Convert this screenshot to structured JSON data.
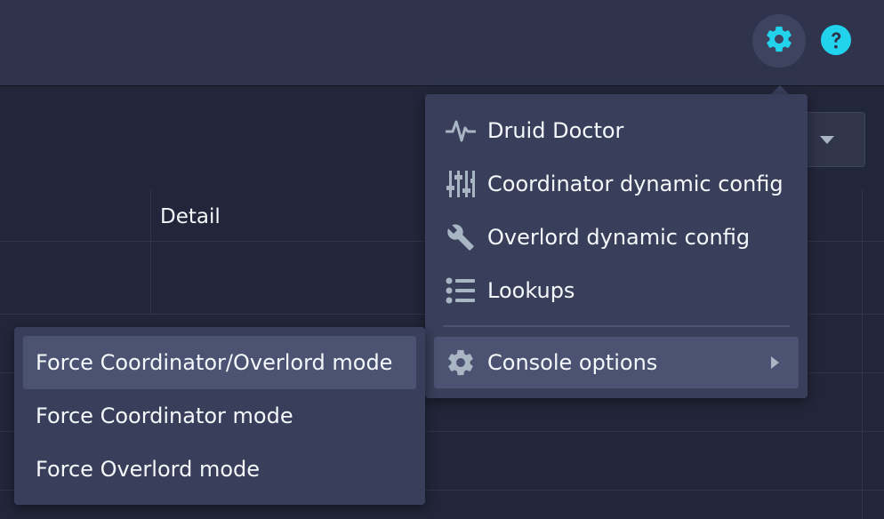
{
  "navbar": {
    "settings_icon": "gear-icon",
    "help_icon": "help-icon",
    "accent_color": "#22d3ee"
  },
  "table": {
    "columns": [
      "",
      "Detail"
    ]
  },
  "settings_menu": {
    "items": [
      {
        "label": "Druid Doctor",
        "icon": "pulse-icon"
      },
      {
        "label": "Coordinator dynamic config",
        "icon": "sliders-icon"
      },
      {
        "label": "Overlord dynamic config",
        "icon": "wrench-icon"
      },
      {
        "label": "Lookups",
        "icon": "list-icon"
      }
    ],
    "console_options": {
      "label": "Console options",
      "icon": "cog-icon"
    }
  },
  "console_options_submenu": {
    "items": [
      {
        "label": "Force Coordinator/Overlord mode"
      },
      {
        "label": "Force Coordinator mode"
      },
      {
        "label": "Force Overlord mode"
      }
    ]
  }
}
